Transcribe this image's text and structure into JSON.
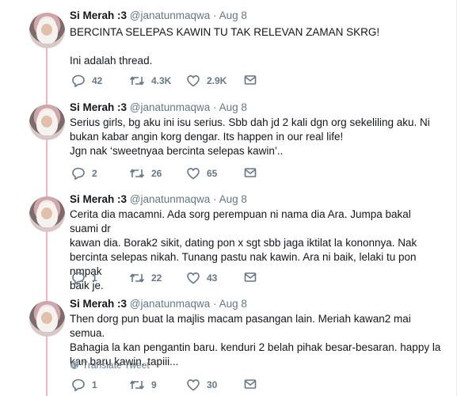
{
  "tweets": [
    {
      "name": "Si Merah :3",
      "handle": "@janatunmaqwa",
      "date": "Aug 8",
      "lines": [
        "BERCINTA SELEPAS KAWIN TU TAK RELEVAN ZAMAN SKRG!",
        "",
        "Ini adalah thread."
      ],
      "replies": "42",
      "retweets": "4.3K",
      "likes": "2.9K"
    },
    {
      "name": "Si Merah :3",
      "handle": "@janatunmaqwa",
      "date": "Aug 8",
      "lines": [
        "Serius girls, bg aku ini isu serius. Sbb dah jd 2 kali dgn org sekeliling aku. Ni",
        "bukan kabar angin korg dengar. Its happen in our real life!",
        "Jgn nak ‘sweetnyaa bercinta selepas kawin’.."
      ],
      "replies": "2",
      "retweets": "26",
      "likes": "65"
    },
    {
      "name": "Si Merah :3",
      "handle": "@janatunmaqwa",
      "date": "Aug 8",
      "lines": [
        "Cerita dia macamni. Ada sorg perempuan ni nama dia Ara. Jumpa bakal suami dr",
        "kawan dia. Borak2 sikit, dating pon x sgt sbb jaga iktilat la kononnya. Nak",
        "bercinta selepas nikah. Tunang pastu nak kawin. Ara ni baik, lelaki tu pon nmpak",
        "baik je."
      ],
      "replies": "1",
      "retweets": "22",
      "likes": "43"
    },
    {
      "name": "Si Merah :3",
      "handle": "@janatunmaqwa",
      "date": "Aug 8",
      "lines": [
        "Then dorg pun buat la majlis macam pasangan lain. Meriah kawan2 mai semua.",
        "Bahagia la kan pengantin baru. kenduri 2 belah pihak besar-besaran. happy la",
        "kan baru kawin. tapiii..."
      ],
      "translate": "Translate Tweet",
      "replies": "1",
      "retweets": "9",
      "likes": "30"
    }
  ]
}
